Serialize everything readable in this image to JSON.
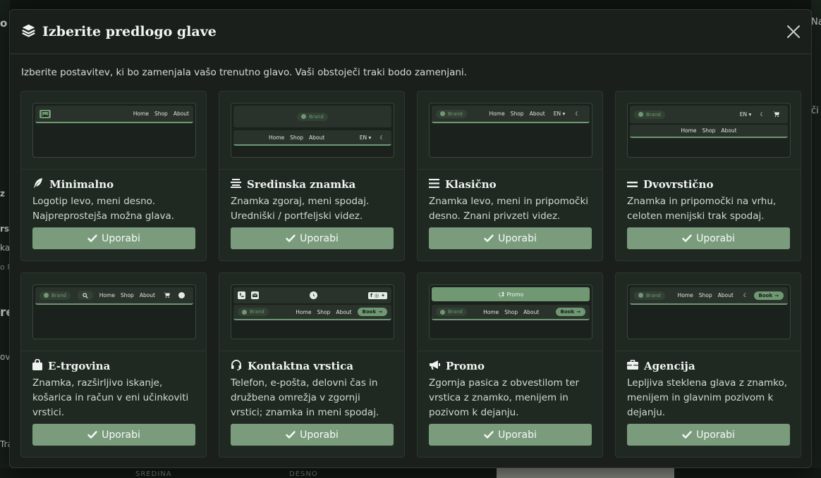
{
  "modal": {
    "title": "Izberite predlogo glave",
    "intro": "Izberite postavitev, ki bo zamenjala vašo trenutno glavo. Vaši obstoječi traki bodo zamenjani."
  },
  "preview": {
    "home": "Home",
    "shop": "Shop",
    "about": "About",
    "brand": "Brand",
    "lang": "EN",
    "book": "Book",
    "promo": "Promo"
  },
  "cards": [
    {
      "title": "Minimalno",
      "icon": "feather-icon",
      "desc": "Logotip levo, meni desno. Najpreprostejša možna glava.",
      "button": "Uporabi"
    },
    {
      "title": "Sredinska znamka",
      "icon": "align-center-icon",
      "desc": "Znamka zgoraj, meni spodaj. Uredniški / portfeljski videz.",
      "button": "Uporabi"
    },
    {
      "title": "Klasično",
      "icon": "bars-icon",
      "desc": "Znamka levo, meni in pripomočki desno. Znani privzeti videz.",
      "button": "Uporabi"
    },
    {
      "title": "Dvovrstično",
      "icon": "equals-icon",
      "desc": "Znamka in pripomočki na vrhu, celoten menijski trak spodaj.",
      "button": "Uporabi"
    },
    {
      "title": "E-trgovina",
      "icon": "shopping-bag-icon",
      "desc": "Znamka, razširljivo iskanje, košarica in račun v eni učinkoviti vrstici.",
      "button": "Uporabi"
    },
    {
      "title": "Kontaktna vrstica",
      "icon": "headset-icon",
      "desc": "Telefon, e-pošta, delovni čas in družbena omrežja v zgornji vrstici; znamka in meni spodaj.",
      "button": "Uporabi"
    },
    {
      "title": "Promo",
      "icon": "bullhorn-icon",
      "desc": "Zgornja pasica z obvestilom ter vrstica z znamko, menijem in pozivom k dejanju.",
      "button": "Uporabi"
    },
    {
      "title": "Agencija",
      "icon": "briefcase-icon",
      "desc": "Lepljiva steklena glava z znamko, menijem in glavnim pozivom k dejanju.",
      "button": "Uporabi"
    }
  ],
  "background": {
    "left_frags": [
      "o",
      "z",
      "rs",
      "ka",
      "o P",
      "re",
      "ov",
      "Tra"
    ],
    "right_frags": [
      "Na",
      "či"
    ],
    "footer_left": "SREDINA",
    "footer_right": "DESNO"
  },
  "colors": {
    "accent": "#7a9c7d",
    "modal_bg": "#1a1f1b",
    "card_bg": "#202822"
  }
}
